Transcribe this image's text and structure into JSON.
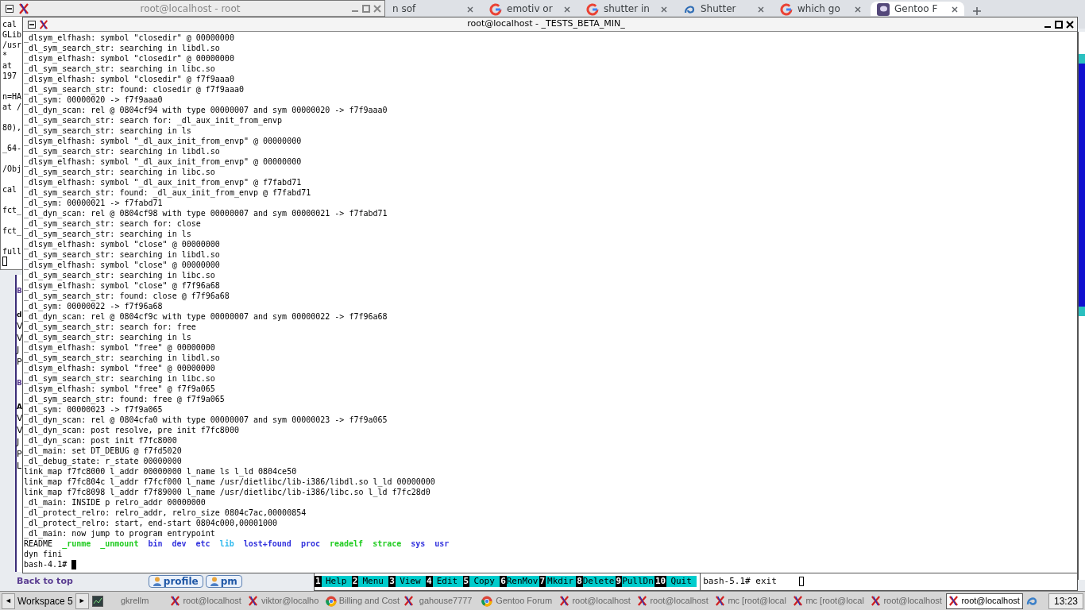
{
  "browser": {
    "tabs": [
      {
        "label": "n sof",
        "kind": "plain",
        "selected": false
      },
      {
        "label": "emotiv or",
        "kind": "google",
        "selected": false
      },
      {
        "label": "shutter in",
        "kind": "google",
        "selected": false
      },
      {
        "label": "Shutter",
        "kind": "shutter",
        "selected": false
      },
      {
        "label": "which go",
        "kind": "google",
        "selected": false
      },
      {
        "label": "Gentoo F",
        "kind": "gentoo",
        "selected": true
      }
    ],
    "page": {
      "fragments": [
        {
          "text": "B",
          "kind": "heading"
        },
        {
          "text": "d",
          "kind": "bold"
        },
        {
          "text": "V",
          "kind": "text"
        },
        {
          "text": "V",
          "kind": "text"
        },
        {
          "text": "J",
          "kind": "text"
        },
        {
          "text": "P",
          "kind": "text"
        },
        {
          "text": "B",
          "kind": "heading"
        },
        {
          "text": "A",
          "kind": "bold"
        },
        {
          "text": "V",
          "kind": "text"
        },
        {
          "text": "V",
          "kind": "text"
        },
        {
          "text": "J",
          "kind": "text"
        },
        {
          "text": "P",
          "kind": "text"
        },
        {
          "text": "L",
          "kind": "text"
        }
      ],
      "back_link": "Back to top",
      "buttons": [
        {
          "label": "profile"
        },
        {
          "label": "pm"
        }
      ]
    }
  },
  "back_terminal": {
    "title": "root@localhost - root",
    "active": false,
    "lines": [
      {
        "kind": "text",
        "text": "cal"
      },
      {
        "kind": "text",
        "text": "GLib"
      },
      {
        "kind": "text",
        "text": "/usr"
      },
      {
        "kind": "text",
        "text": "*"
      },
      {
        "kind": "text",
        "text": "at"
      },
      {
        "kind": "text",
        "text": "197"
      },
      {
        "kind": "blank"
      },
      {
        "kind": "text",
        "text": "n=HA"
      },
      {
        "kind": "text",
        "text": "at /"
      },
      {
        "kind": "blank"
      },
      {
        "kind": "text",
        "text": "80),"
      },
      {
        "kind": "blank"
      },
      {
        "kind": "text",
        "text": "_64-"
      },
      {
        "kind": "blank"
      },
      {
        "kind": "text",
        "text": "/Obj"
      },
      {
        "kind": "blank"
      },
      {
        "kind": "text",
        "text": "cal"
      },
      {
        "kind": "blank"
      },
      {
        "kind": "text",
        "text": "fct_"
      },
      {
        "kind": "blank"
      },
      {
        "kind": "text",
        "text": "fct_"
      },
      {
        "kind": "blank"
      },
      {
        "kind": "text",
        "text": "full"
      }
    ]
  },
  "main_terminal": {
    "title": "root@localhost - _TESTS_BETA_MIN_",
    "active": true,
    "lines": [
      "_dlsym_elfhash: symbol \"closedir\" @ 00000000",
      "_dl_sym_search_str: searching in libdl.so",
      "_dlsym_elfhash: symbol \"closedir\" @ 00000000",
      "_dl_sym_search_str: searching in libc.so",
      "_dlsym_elfhash: symbol \"closedir\" @ f7f9aaa0",
      "_dl_sym_search_str: found: closedir @ f7f9aaa0",
      "_dl_sym: 00000020 -> f7f9aaa0",
      "_dl_dyn_scan: rel @ 0804cf94 with type 00000007 and sym 00000020 -> f7f9aaa0",
      "_dl_sym_search_str: search for: _dl_aux_init_from_envp",
      "_dl_sym_search_str: searching in ls",
      "_dlsym_elfhash: symbol \"_dl_aux_init_from_envp\" @ 00000000",
      "_dl_sym_search_str: searching in libdl.so",
      "_dlsym_elfhash: symbol \"_dl_aux_init_from_envp\" @ 00000000",
      "_dl_sym_search_str: searching in libc.so",
      "_dlsym_elfhash: symbol \"_dl_aux_init_from_envp\" @ f7fabd71",
      "_dl_sym_search_str: found: _dl_aux_init_from_envp @ f7fabd71",
      "_dl_sym: 00000021 -> f7fabd71",
      "_dl_dyn_scan: rel @ 0804cf98 with type 00000007 and sym 00000021 -> f7fabd71",
      "_dl_sym_search_str: search for: close",
      "_dl_sym_search_str: searching in ls",
      "_dlsym_elfhash: symbol \"close\" @ 00000000",
      "_dl_sym_search_str: searching in libdl.so",
      "_dlsym_elfhash: symbol \"close\" @ 00000000",
      "_dl_sym_search_str: searching in libc.so",
      "_dlsym_elfhash: symbol \"close\" @ f7f96a68",
      "_dl_sym_search_str: found: close @ f7f96a68",
      "_dl_sym: 00000022 -> f7f96a68",
      "_dl_dyn_scan: rel @ 0804cf9c with type 00000007 and sym 00000022 -> f7f96a68",
      "_dl_sym_search_str: search for: free",
      "_dl_sym_search_str: searching in ls",
      "_dlsym_elfhash: symbol \"free\" @ 00000000",
      "_dl_sym_search_str: searching in libdl.so",
      "_dlsym_elfhash: symbol \"free\" @ 00000000",
      "_dl_sym_search_str: searching in libc.so",
      "_dlsym_elfhash: symbol \"free\" @ f7f9a065",
      "_dl_sym_search_str: found: free @ f7f9a065",
      "_dl_sym: 00000023 -> f7f9a065",
      "_dl_dyn_scan: rel @ 0804cfa0 with type 00000007 and sym 00000023 -> f7f9a065",
      "_dl_dyn_scan: post resolve, pre init f7fc8000",
      "_dl_dyn_scan: post init f7fc8000",
      "_dl_main: set DT_DEBUG @ f7fd5020",
      "_dl_debug_state: r_state 00000000",
      "link_map f7fc8000 l_addr 00000000 l_name ls l_ld 0804ce50",
      "link_map f7fc804c l_addr f7fcf000 l_name /usr/dietlibc/lib-i386/libdl.so l_ld 00000000",
      "link_map f7fc8098 l_addr f7f89000 l_name /usr/dietlibc/lib-i386/libc.so l_ld f7fc28d0",
      "_dl_main: INSIDE p relro_addr 00000000",
      "_dl_protect_relro: relro_addr, relro_size 0804c7ac,00000854",
      "_dl_protect_relro: start, end-start 0804c000,00001000",
      "_dl_main: now jump to program entrypoint"
    ],
    "listing": [
      {
        "name": "README",
        "kind": "file"
      },
      {
        "name": "_runme",
        "kind": "exec"
      },
      {
        "name": "_unmount",
        "kind": "exec"
      },
      {
        "name": "bin",
        "kind": "dir"
      },
      {
        "name": "dev",
        "kind": "dir"
      },
      {
        "name": "etc",
        "kind": "dir"
      },
      {
        "name": "lib",
        "kind": "link"
      },
      {
        "name": "lost+found",
        "kind": "dir"
      },
      {
        "name": "proc",
        "kind": "dir"
      },
      {
        "name": "readelf",
        "kind": "exec"
      },
      {
        "name": "strace",
        "kind": "exec"
      },
      {
        "name": "sys",
        "kind": "dir"
      },
      {
        "name": "usr",
        "kind": "dir"
      }
    ],
    "after": [
      "dyn fini"
    ],
    "prompt": "bash-4.1#"
  },
  "mc": {
    "keys": [
      {
        "number": "1",
        "label": "Help"
      },
      {
        "number": "2",
        "label": "Menu"
      },
      {
        "number": "3",
        "label": "View"
      },
      {
        "number": "4",
        "label": "Edit"
      },
      {
        "number": "5",
        "label": "Copy"
      },
      {
        "number": "6",
        "label": "RenMov"
      },
      {
        "number": "7",
        "label": "Mkdir"
      },
      {
        "number": "8",
        "label": "Delete"
      },
      {
        "number": "9",
        "label": "PullDn"
      },
      {
        "number": "10",
        "label": "Quit"
      }
    ],
    "command_line": "bash-5.1# exit"
  },
  "taskbar": {
    "prev": "◄",
    "workspace": "Workspace 5",
    "next": "►",
    "items": [
      {
        "label": "gkrellm",
        "kind": "monitor",
        "selected": false
      },
      {
        "label": "root@localhost",
        "kind": "xterm",
        "selected": false
      },
      {
        "label": "viktor@localho",
        "kind": "xterm",
        "selected": false
      },
      {
        "label": "Billing and Cost",
        "kind": "chrome",
        "selected": false
      },
      {
        "label": "gahouse7777",
        "kind": "xterm",
        "selected": false
      },
      {
        "label": "Gentoo Forum",
        "kind": "chrome",
        "selected": false
      },
      {
        "label": "root@localhost",
        "kind": "xterm",
        "selected": false
      },
      {
        "label": "root@localhost",
        "kind": "xterm",
        "selected": false
      },
      {
        "label": "mc [root@local",
        "kind": "xterm",
        "selected": false
      },
      {
        "label": "mc [root@local",
        "kind": "xterm",
        "selected": false
      },
      {
        "label": "root@localhost",
        "kind": "xterm",
        "selected": false
      },
      {
        "label": "root@localhost",
        "kind": "xterm",
        "selected": true
      }
    ],
    "clock": "13:23"
  }
}
